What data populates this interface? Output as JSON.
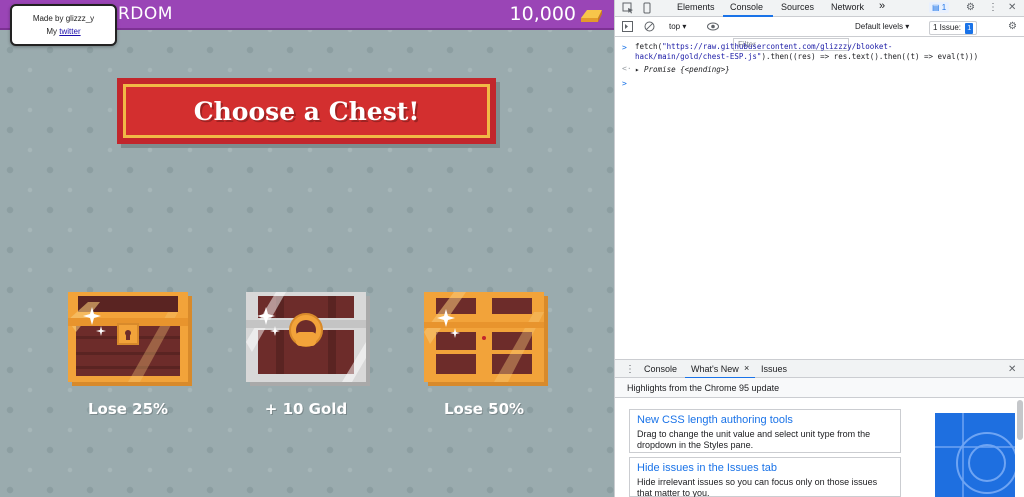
{
  "game": {
    "mode_title": "RDOM",
    "gold": "10,000",
    "credit": {
      "line1": "Made by glizzz_y",
      "prefix": "My ",
      "link": "twitter"
    },
    "banner_title": "Choose a Chest!",
    "chests": [
      {
        "label": "Lose 25%"
      },
      {
        "label": "+ 10 Gold"
      },
      {
        "label": "Lose 50%"
      }
    ],
    "colors": {
      "topbar": "#9a45b6",
      "background": "#9aabae",
      "banner": "#d32f2f",
      "banner_border": "#f1b946",
      "chest_orange": "#f2a33a",
      "chest_wood": "#6d2c2a"
    }
  },
  "devtools": {
    "tabs": [
      "Elements",
      "Console",
      "Sources",
      "Network"
    ],
    "active_tab": "Console",
    "more": "»",
    "messages_badge": "1",
    "context": "top",
    "filter_placeholder": "Filter",
    "levels": "Default levels",
    "issues_label": "1 Issue:",
    "issues_count": "1",
    "console": {
      "input_prefix": "fetch(",
      "input_url_1": "\"https://raw.githubusercontent.com/glizzzy/blooket-",
      "input_url_2": "hack/main/gold/chest-ESP.js\"",
      "input_rest_2": ").then((res) => res.text().then((t) => eval(t)))",
      "result": "Promise {<pending>}"
    },
    "drawer": {
      "tabs": [
        "Console",
        "What's New",
        "Issues"
      ],
      "active_tab": "What's New",
      "close": "×",
      "highlights": "Highlights from the Chrome 95 update",
      "cards": [
        {
          "title": "New CSS length authoring tools",
          "body": "Drag to change the unit value and select unit type from the dropdown in the Styles pane."
        },
        {
          "title": "Hide issues in the Issues tab",
          "body": "Hide irrelevant issues so you can focus only on those issues that matter to you."
        }
      ]
    },
    "colors": {
      "accent": "#1a73e8",
      "border": "#cbcdd1",
      "toolbar": "#f1f3f4"
    }
  }
}
